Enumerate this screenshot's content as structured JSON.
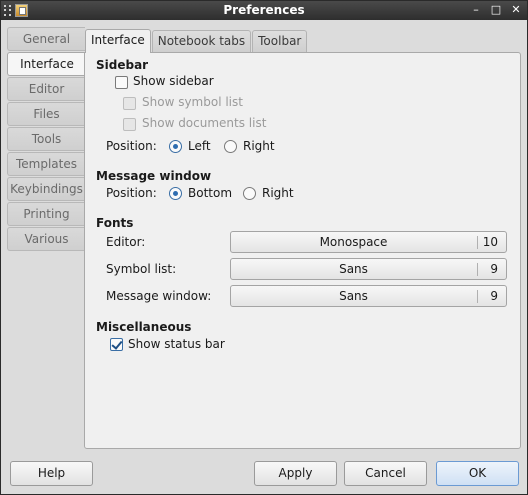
{
  "window": {
    "title": "Preferences"
  },
  "side_tabs": [
    "General",
    "Interface",
    "Editor",
    "Files",
    "Tools",
    "Templates",
    "Keybindings",
    "Printing",
    "Various"
  ],
  "top_tabs": [
    "Interface",
    "Notebook tabs",
    "Toolbar"
  ],
  "sidebar": {
    "title": "Sidebar",
    "show_sidebar": "Show sidebar",
    "show_symbol_list": "Show symbol list",
    "show_documents_list": "Show documents list",
    "position_label": "Position:",
    "left": "Left",
    "right": "Right"
  },
  "message_window": {
    "title": "Message window",
    "position_label": "Position:",
    "bottom": "Bottom",
    "right": "Right"
  },
  "fonts": {
    "title": "Fonts",
    "editor_label": "Editor:",
    "editor_font": "Monospace",
    "editor_size": "10",
    "symbol_label": "Symbol list:",
    "symbol_font": "Sans",
    "symbol_size": "9",
    "message_label": "Message window:",
    "message_font": "Sans",
    "message_size": "9"
  },
  "misc": {
    "title": "Miscellaneous",
    "show_status_bar": "Show status bar"
  },
  "buttons": {
    "help": "Help",
    "apply": "Apply",
    "cancel": "Cancel",
    "ok": "OK"
  },
  "titlebar_controls": {
    "minimize": "–",
    "maximize": "□",
    "close": "✕"
  }
}
